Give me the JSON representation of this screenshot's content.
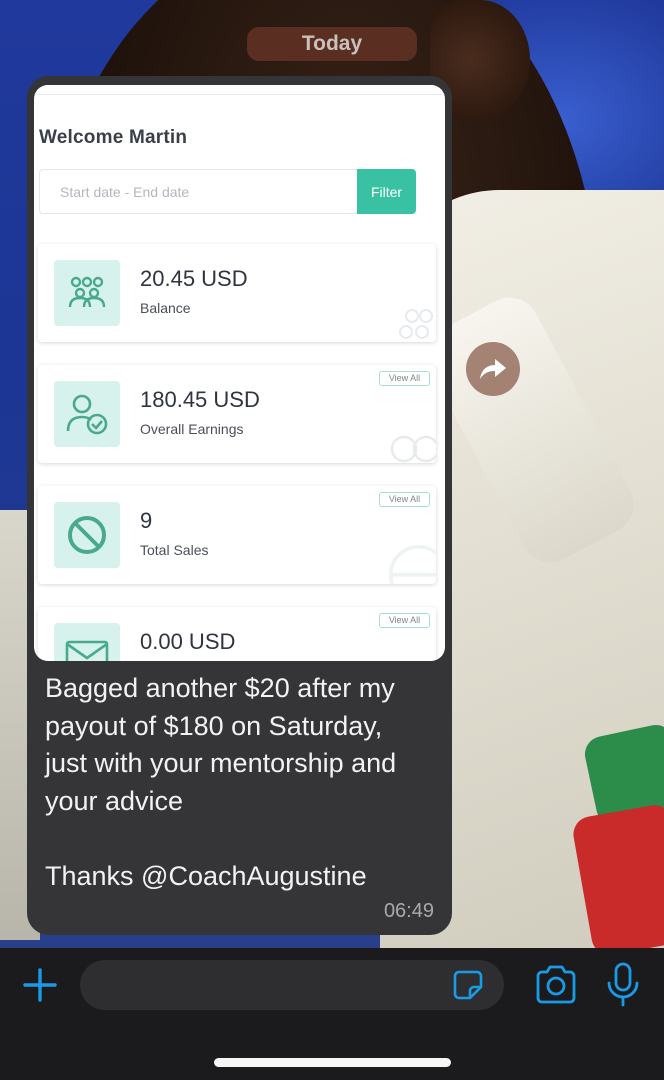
{
  "chat": {
    "date_separator": "Today",
    "message": {
      "lines": [
        "Bagged another $20 after my",
        "payout of $180 on Saturday,",
        "just with your mentorship and",
        "your advice",
        "Thanks @CoachAugustine"
      ],
      "time": "06:49"
    }
  },
  "attached_screenshot": {
    "welcome": "Welcome Martin",
    "date_placeholder": "Start date - End date",
    "filter_label": "Filter",
    "cards": [
      {
        "value": "20.45 USD",
        "label": "Balance",
        "icon": "users-group-icon",
        "view_all": ""
      },
      {
        "value": "180.45 USD",
        "label": "Overall Earnings",
        "icon": "user-check-icon",
        "view_all": "View All"
      },
      {
        "value": "9",
        "label": "Total Sales",
        "icon": "ban-icon",
        "view_all": "View All"
      },
      {
        "value": "0.00 USD",
        "label": "",
        "icon": "mail-icon",
        "view_all": "View All"
      }
    ]
  },
  "composer": {
    "placeholder": "",
    "icons": [
      "plus-icon",
      "sticker-icon",
      "camera-icon",
      "mic-icon"
    ]
  },
  "colors": {
    "accent": "#1a9be8",
    "bubble": "#353537",
    "teal": "#38c1a2"
  }
}
